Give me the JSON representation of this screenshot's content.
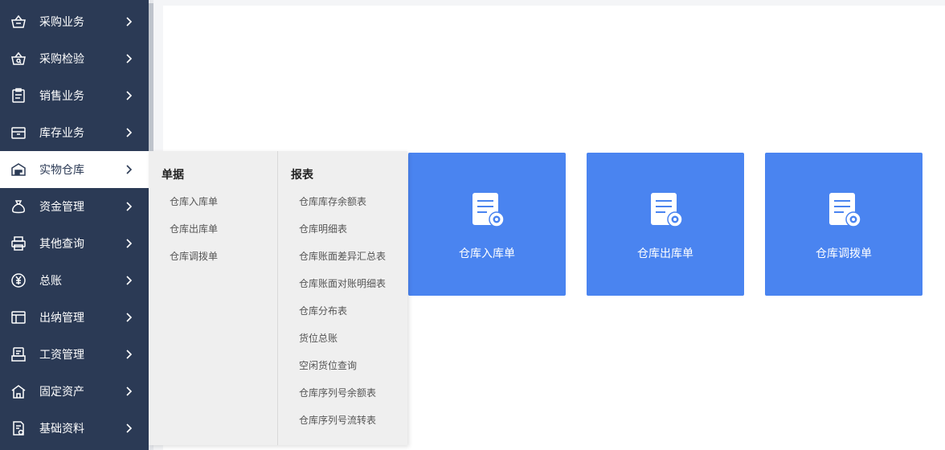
{
  "sidebar": {
    "items": [
      {
        "label": "采购业务",
        "icon": "basket-icon"
      },
      {
        "label": "采购检验",
        "icon": "basket-inspect-icon"
      },
      {
        "label": "销售业务",
        "icon": "clipboard-icon"
      },
      {
        "label": "库存业务",
        "icon": "inbox-icon"
      },
      {
        "label": "实物仓库",
        "icon": "warehouse-icon"
      },
      {
        "label": "资金管理",
        "icon": "money-bag-icon"
      },
      {
        "label": "其他查询",
        "icon": "printer-icon"
      },
      {
        "label": "总账",
        "icon": "yen-circle-icon"
      },
      {
        "label": "出纳管理",
        "icon": "layout-icon"
      },
      {
        "label": "工资管理",
        "icon": "payroll-icon"
      },
      {
        "label": "固定资产",
        "icon": "house-icon"
      },
      {
        "label": "基础资料",
        "icon": "document-settings-icon"
      }
    ],
    "active_index": 4
  },
  "flyout": {
    "documents": {
      "heading": "单据",
      "links": [
        "仓库入库单",
        "仓库出库单",
        "仓库调拨单"
      ]
    },
    "reports": {
      "heading": "报表",
      "links": [
        "仓库库存余额表",
        "仓库明细表",
        "仓库账面差异汇总表",
        "仓库账面对账明细表",
        "仓库分布表",
        "货位总账",
        "空闲货位查询",
        "仓库序列号余额表",
        "仓库序列号流转表"
      ]
    }
  },
  "cards": [
    {
      "label": "仓库入库单"
    },
    {
      "label": "仓库出库单"
    },
    {
      "label": "仓库调拨单"
    }
  ],
  "colors": {
    "sidebar_bg": "#2b3a55",
    "card_bg": "#4a84f0",
    "flyout_bg": "#efefef"
  }
}
